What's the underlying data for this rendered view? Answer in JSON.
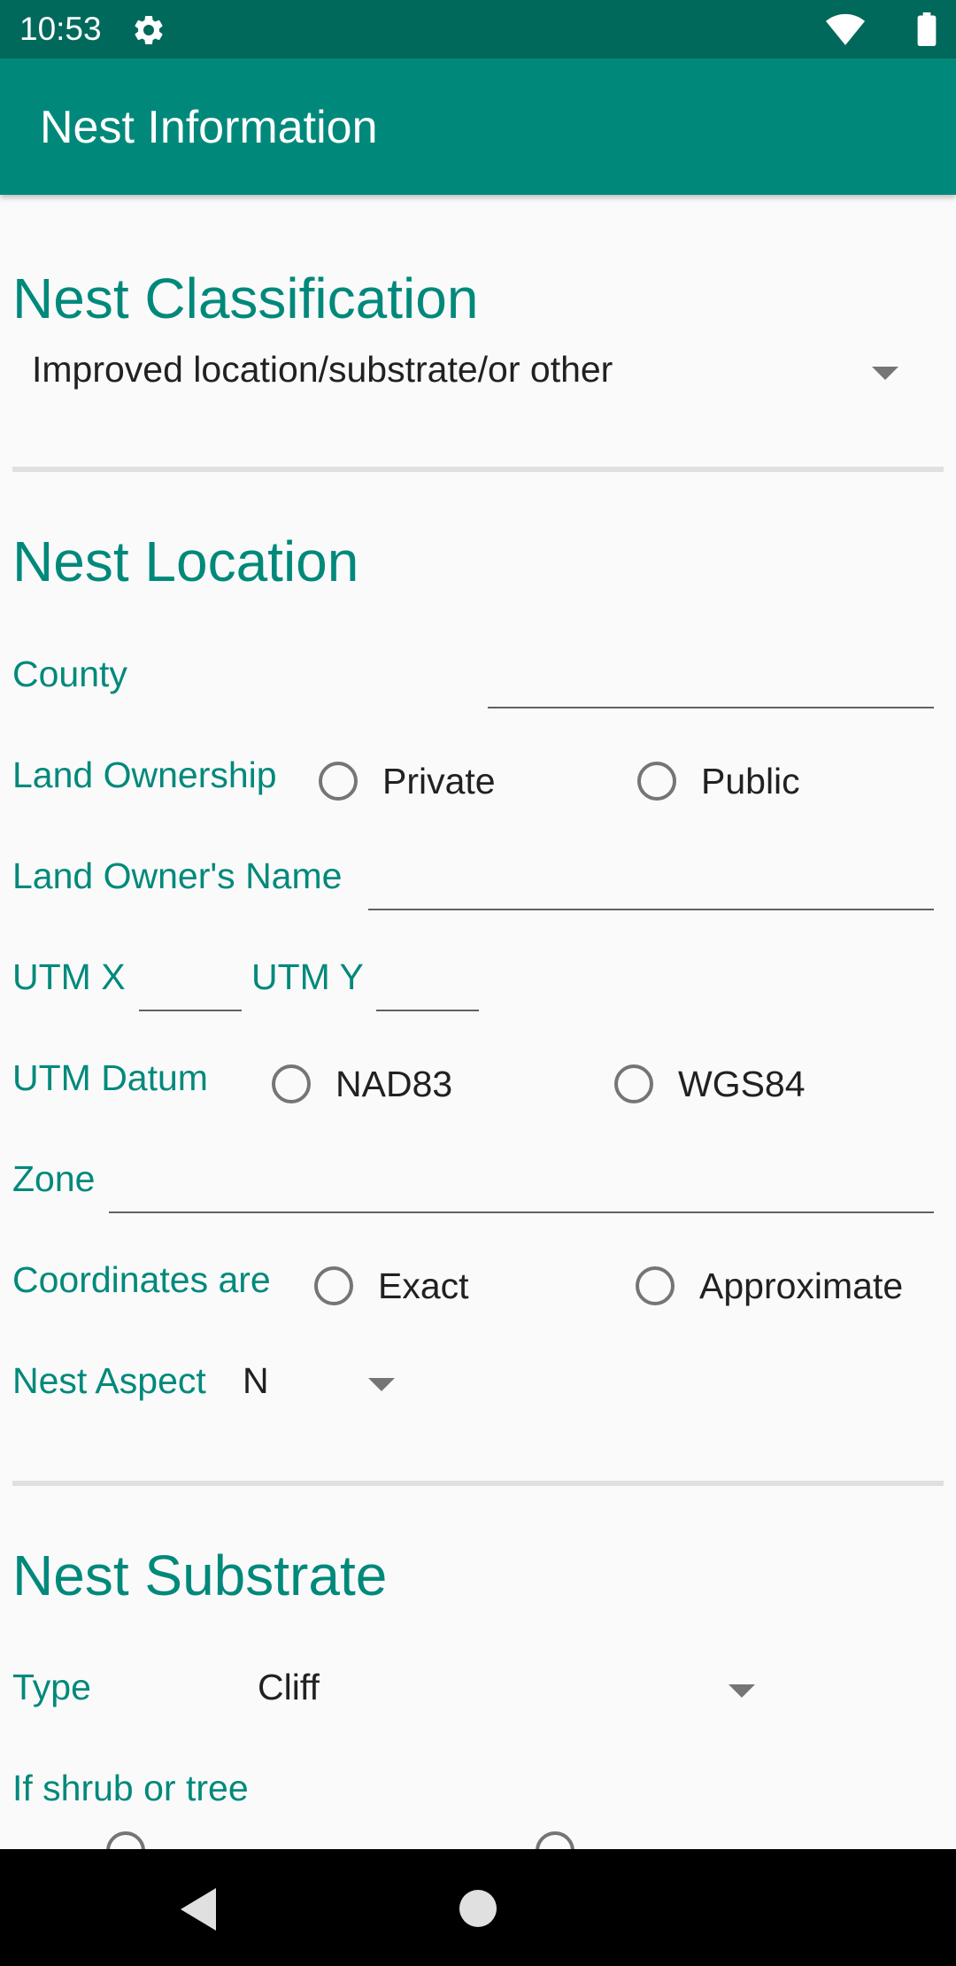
{
  "status_bar": {
    "time": "10:53"
  },
  "app_bar": {
    "title": "Nest Information"
  },
  "classification": {
    "title": "Nest Classification",
    "selected": "Improved location/substrate/or other"
  },
  "location": {
    "title": "Nest Location",
    "county_label": "County",
    "ownership_label": "Land Ownership",
    "ownership_options": [
      "Private",
      "Public"
    ],
    "owner_name_label": "Land Owner's Name",
    "utm_x_label": "UTM X",
    "utm_y_label": "UTM Y",
    "datum_label": "UTM Datum",
    "datum_options": [
      "NAD83",
      "WGS84"
    ],
    "zone_label": "Zone",
    "coords_label": "Coordinates are",
    "coords_options": [
      "Exact",
      "Approximate"
    ],
    "aspect_label": "Nest Aspect",
    "aspect_value": "N"
  },
  "substrate": {
    "title": "Nest Substrate",
    "type_label": "Type",
    "type_value": "Cliff",
    "shrub_label": "If shrub or tree"
  },
  "colors": {
    "primary": "#00897b",
    "primary_dark": "#00695c"
  }
}
